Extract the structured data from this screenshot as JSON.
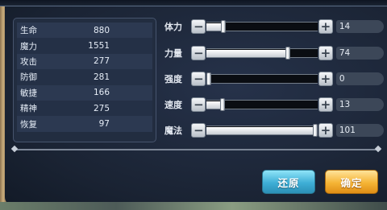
{
  "stats": [
    {
      "name": "生命",
      "value": "880"
    },
    {
      "name": "魔力",
      "value": "1551"
    },
    {
      "name": "攻击",
      "value": "277"
    },
    {
      "name": "防御",
      "value": "281"
    },
    {
      "name": "敏捷",
      "value": "166"
    },
    {
      "name": "精神",
      "value": "275"
    },
    {
      "name": "恢复",
      "value": "97"
    }
  ],
  "sliders": [
    {
      "label": "体力",
      "value": "14",
      "level": 0.14
    },
    {
      "label": "力量",
      "value": "74",
      "level": 0.74
    },
    {
      "label": "强度",
      "value": "0",
      "level": 0.0
    },
    {
      "label": "速度",
      "value": "13",
      "level": 0.13
    },
    {
      "label": "魔法",
      "value": "101",
      "level": 1.0
    }
  ],
  "buttons": {
    "reset": "还原",
    "confirm": "确定"
  },
  "icons": {
    "minus": "minus-icon",
    "plus": "plus-icon"
  },
  "colors": {
    "reset_button": "#3eaed6",
    "confirm_button": "#f5b435",
    "panel": "#1a2333"
  }
}
